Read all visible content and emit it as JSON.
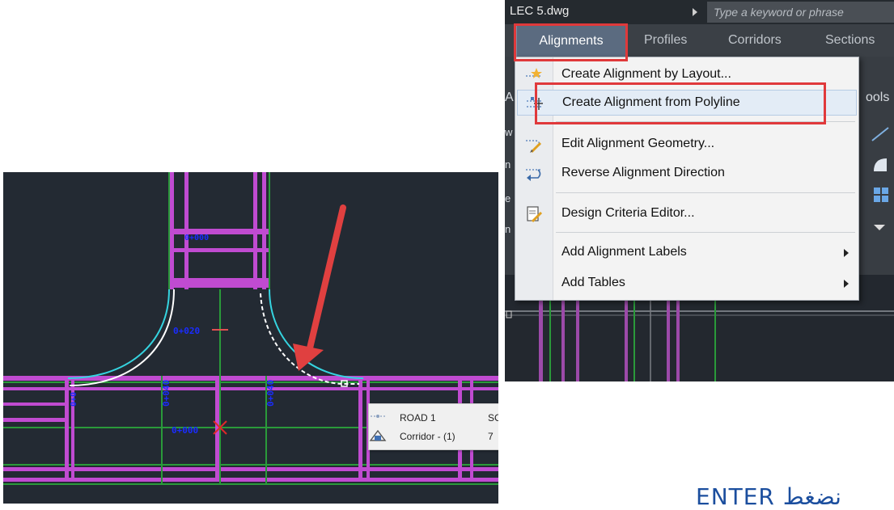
{
  "cad": {
    "station_labels": [
      "0+020",
      "0+040",
      "0+040",
      "0+000",
      "0+000",
      "0+0"
    ],
    "tooltip": {
      "rows": [
        {
          "icon": "alignment-icon",
          "name": "ROAD 1",
          "extra": "SC"
        },
        {
          "icon": "corridor-icon",
          "name": "Corridor - (1)",
          "extra": "7"
        }
      ]
    },
    "colors": {
      "background": "#232a33",
      "road": "#c04bd1",
      "centerline": "#2a9a3a",
      "curve": "#35d4e0",
      "station": "#1a2cff",
      "arrow": "#e04040"
    }
  },
  "menu_window": {
    "doc_title": "LEC 5.dwg",
    "search_placeholder": "Type a keyword or phrase",
    "tabs": [
      "Alignments",
      "Profiles",
      "Corridors",
      "Sections"
    ],
    "dropdown": {
      "items": [
        {
          "icon": "alignment-layout-icon",
          "label": "Create Alignment by Layout..."
        },
        {
          "icon": "alignment-polyline-icon",
          "label": "Create Alignment from Polyline"
        },
        {
          "icon": "edit-geometry-icon",
          "label": "Edit Alignment Geometry..."
        },
        {
          "icon": "reverse-direction-icon",
          "label": "Reverse Alignment Direction"
        },
        {
          "icon": "design-criteria-icon",
          "label": "Design Criteria Editor..."
        },
        {
          "label": "Add Alignment Labels"
        },
        {
          "label": "Add Tables"
        }
      ]
    },
    "side_fragments": [
      "A",
      "ools",
      "w",
      "n",
      "e",
      "n"
    ]
  },
  "caption": "ENTER نضغط"
}
